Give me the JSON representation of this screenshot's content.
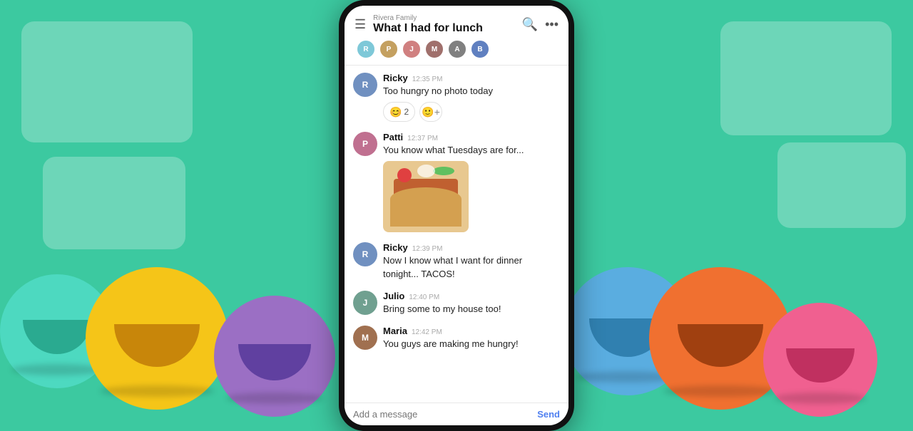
{
  "background": {
    "color": "#3cc9a0"
  },
  "phone": {
    "header": {
      "group_name": "Rivera Family",
      "channel_title": "What I had for lunch",
      "menu_icon": "☰",
      "search_icon": "🔍",
      "more_icon": "⋯",
      "avatars": [
        "R",
        "P",
        "J",
        "M",
        "A",
        "B"
      ]
    },
    "messages": [
      {
        "sender": "Ricky",
        "time": "12:35 PM",
        "text": "Too hungry no photo today",
        "reactions": [
          {
            "emoji": "😊",
            "count": "2"
          }
        ],
        "image": false
      },
      {
        "sender": "Patti",
        "time": "12:37 PM",
        "text": "You know what Tuesdays are for...",
        "reactions": [],
        "image": true
      },
      {
        "sender": "Ricky",
        "time": "12:39 PM",
        "text": "Now I know what I want for dinner tonight... TACOS!",
        "reactions": [],
        "image": false
      },
      {
        "sender": "Julio",
        "time": "12:40 PM",
        "text": "Bring some to my house too!",
        "reactions": [],
        "image": false
      },
      {
        "sender": "Maria",
        "time": "12:42 PM",
        "text": "You guys are making me hungry!",
        "reactions": [],
        "image": false
      }
    ],
    "input": {
      "placeholder": "Add a message",
      "send_label": "Send"
    }
  }
}
